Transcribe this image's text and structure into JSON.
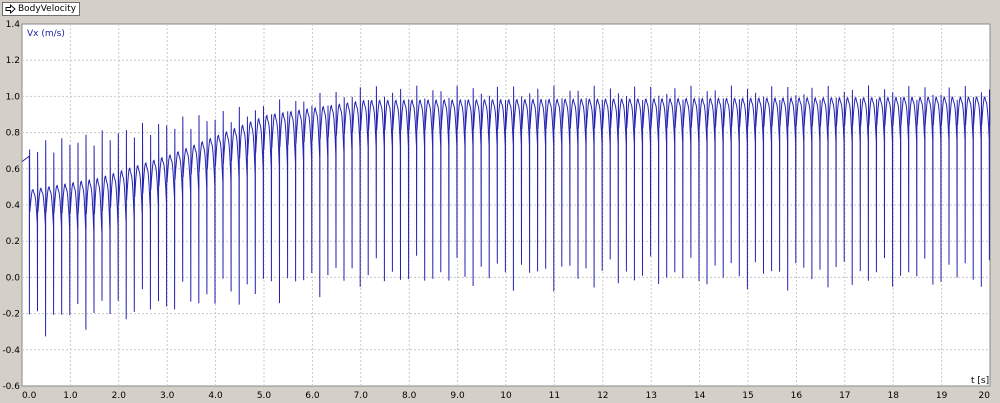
{
  "tab": {
    "label": "BodyVelocity"
  },
  "colors": {
    "series": "#2424b0",
    "plot_bg": "#ffffff",
    "grid": "#c8c8c8",
    "frame_bg": "#d4d0c8"
  },
  "chart_data": {
    "type": "line",
    "title": "",
    "xlabel": "t [s]",
    "ylabel": "Vx (m/s)",
    "xlim": [
      0,
      20
    ],
    "ylim": [
      -0.6,
      1.4
    ],
    "grid": true,
    "x_ticks": [
      {
        "v": 0,
        "label": "0.0"
      },
      {
        "v": 1,
        "label": "1.0"
      },
      {
        "v": 2,
        "label": "2.0"
      },
      {
        "v": 3,
        "label": "3.0"
      },
      {
        "v": 4,
        "label": "4.0"
      },
      {
        "v": 5,
        "label": "5.0"
      },
      {
        "v": 6,
        "label": "6.0"
      },
      {
        "v": 7,
        "label": "7.0"
      },
      {
        "v": 8,
        "label": "8.0"
      },
      {
        "v": 9,
        "label": "9.0"
      },
      {
        "v": 10,
        "label": "10"
      },
      {
        "v": 11,
        "label": "11"
      },
      {
        "v": 12,
        "label": "12"
      },
      {
        "v": 13,
        "label": "13"
      },
      {
        "v": 14,
        "label": "14"
      },
      {
        "v": 15,
        "label": "15"
      },
      {
        "v": 16,
        "label": "16"
      },
      {
        "v": 17,
        "label": "17"
      },
      {
        "v": 18,
        "label": "18"
      },
      {
        "v": 19,
        "label": "19"
      },
      {
        "v": 20,
        "label": "20"
      }
    ],
    "y_ticks": [
      {
        "v": 1.4,
        "label": "1.4"
      },
      {
        "v": 1.2,
        "label": "1.2"
      },
      {
        "v": 1.0,
        "label": "1.0"
      },
      {
        "v": 0.8,
        "label": "0.8"
      },
      {
        "v": 0.6,
        "label": "0.6"
      },
      {
        "v": 0.4,
        "label": "0.4"
      },
      {
        "v": 0.2,
        "label": "0.2"
      },
      {
        "v": 0.0,
        "label": "0.0"
      },
      {
        "v": -0.2,
        "label": "-0.2"
      },
      {
        "v": -0.4,
        "label": "-0.4"
      },
      {
        "v": -0.6,
        "label": "-0.6"
      }
    ],
    "series": [
      {
        "color": "#2424b0",
        "description": "periodic Vx signal, 6 cycles per second, gradually rising baseline",
        "params": {
          "steps_per_second": 6,
          "points_per_step": 12,
          "init": {
            "t0": 0,
            "t1": 0.15,
            "v0": 0.64,
            "v1": 0.67
          },
          "envelope": {
            "min_t": [
              0,
              1.5,
              3,
              5,
              7,
              20
            ],
            "min_v": [
              0.3,
              0.24,
              0.44,
              0.6,
              0.72,
              0.76
            ],
            "max_v": [
              0.48,
              0.55,
              0.68,
              0.9,
              0.98,
              1.0
            ]
          },
          "spike": {
            "low_start": -0.25,
            "low_end": 0.02,
            "low_ramp_t": 7,
            "high_start": 0.7,
            "high_end": 1.02,
            "high_ramp_t": 7
          }
        }
      }
    ]
  }
}
